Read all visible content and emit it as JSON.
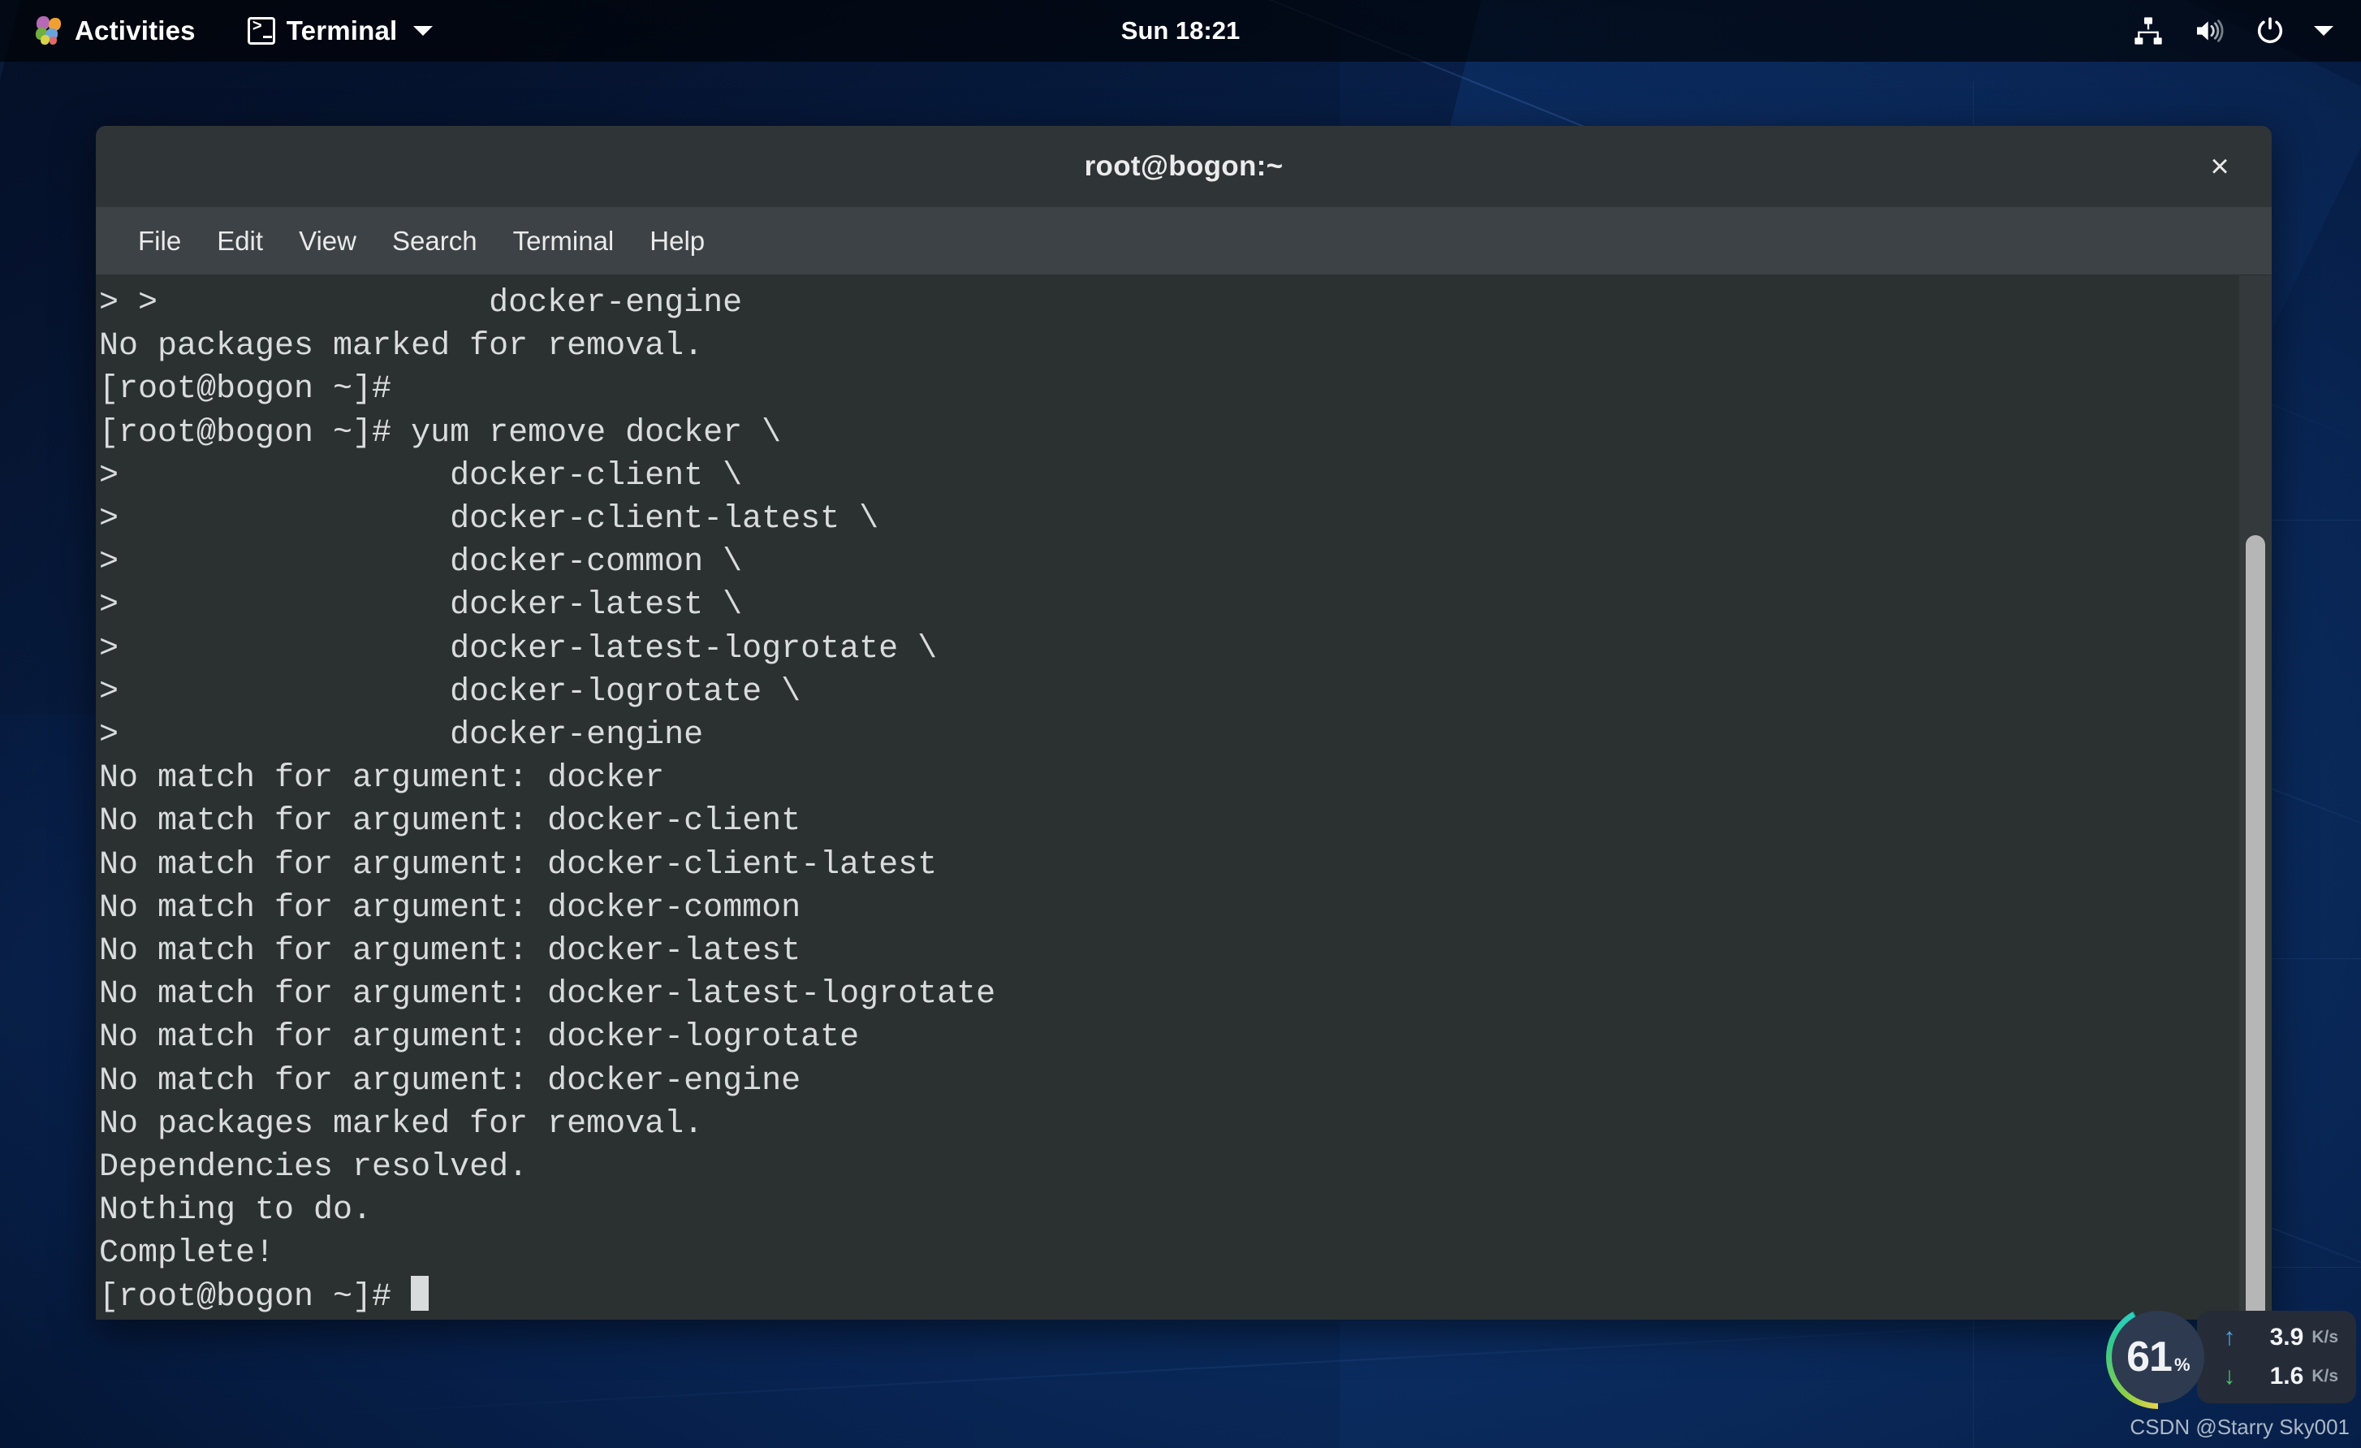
{
  "topbar": {
    "activities_label": "Activities",
    "app_name": "Terminal",
    "clock": "Sun 18:21",
    "icons": {
      "gnome_foot": "gnome-foot-icon",
      "terminal": "terminal-icon",
      "app_menu_chevron": "chevron-down-icon",
      "network": "network-wired-icon",
      "volume": "volume-high-icon",
      "power": "power-icon",
      "system_menu_chevron": "chevron-down-icon"
    }
  },
  "window": {
    "title": "root@bogon:~",
    "close_label": "×",
    "menus": [
      "File",
      "Edit",
      "View",
      "Search",
      "Terminal",
      "Help"
    ]
  },
  "terminal": {
    "lines": [
      "> >                 docker-engine",
      "No packages marked for removal.",
      "[root@bogon ~]#",
      "[root@bogon ~]# yum remove docker \\",
      ">                 docker-client \\",
      ">                 docker-client-latest \\",
      ">                 docker-common \\",
      ">                 docker-latest \\",
      ">                 docker-latest-logrotate \\",
      ">                 docker-logrotate \\",
      ">                 docker-engine",
      "No match for argument: docker",
      "No match for argument: docker-client",
      "No match for argument: docker-client-latest",
      "No match for argument: docker-common",
      "No match for argument: docker-latest",
      "No match for argument: docker-latest-logrotate",
      "No match for argument: docker-logrotate",
      "No match for argument: docker-engine",
      "No packages marked for removal.",
      "Dependencies resolved.",
      "Nothing to do.",
      "Complete!"
    ],
    "prompt": "[root@bogon ~]# ",
    "colors": {
      "background": "#2b3031",
      "foreground": "#d9dcdc"
    }
  },
  "net_widget": {
    "cpu_percent": "61",
    "percent_symbol": "%",
    "upload_value": "3.9",
    "upload_unit": "K/s",
    "upload_arrow": "↑",
    "download_value": "1.6",
    "download_unit": "K/s",
    "download_arrow": "↓",
    "accent_upload": "#46a8e0",
    "accent_download": "#49c469"
  },
  "watermark": "CSDN @Starry Sky001"
}
